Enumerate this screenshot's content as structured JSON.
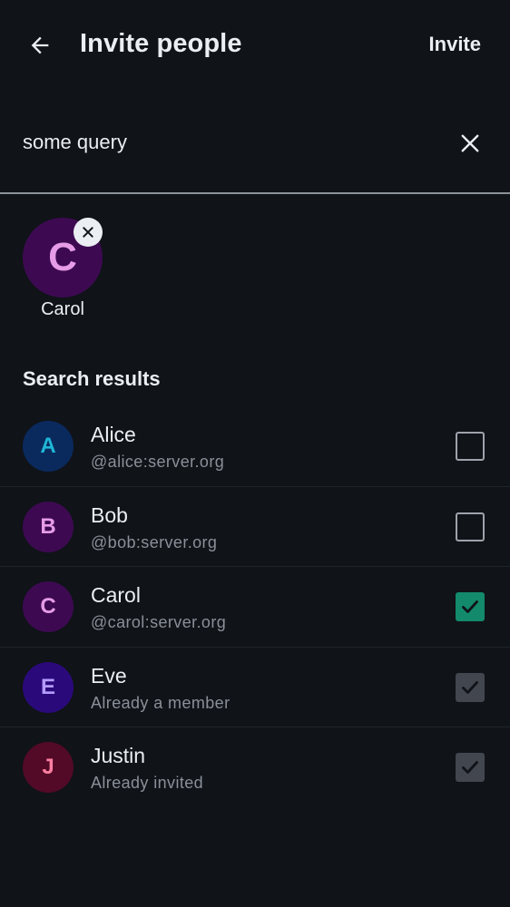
{
  "header": {
    "title": "Invite people",
    "invite_label": "Invite"
  },
  "search": {
    "value": "some query",
    "placeholder": ""
  },
  "selected": [
    {
      "initial": "C",
      "name": "Carol",
      "bg": "#3d0a52",
      "fg": "#e69ce6"
    }
  ],
  "results": {
    "title": "Search results",
    "items": [
      {
        "initial": "A",
        "name": "Alice",
        "sub": "@alice:server.org",
        "state": "unchecked",
        "bg": "#0a2a5e",
        "fg": "#1fb6d6"
      },
      {
        "initial": "B",
        "name": "Bob",
        "sub": "@bob:server.org",
        "state": "unchecked",
        "bg": "#3d0a52",
        "fg": "#e69ce6"
      },
      {
        "initial": "C",
        "name": "Carol",
        "sub": "@carol:server.org",
        "state": "checked",
        "bg": "#3d0a52",
        "fg": "#e69ce6"
      },
      {
        "initial": "E",
        "name": "Eve",
        "sub": "Already a member",
        "state": "disabled",
        "bg": "#2a0a7a",
        "fg": "#b49cff"
      },
      {
        "initial": "J",
        "name": "Justin",
        "sub": "Already invited",
        "state": "disabled",
        "bg": "#520a26",
        "fg": "#ff7fa3"
      }
    ]
  },
  "colors": {
    "accent": "#138a6c",
    "background": "#101318",
    "divider": "#8c929a"
  }
}
